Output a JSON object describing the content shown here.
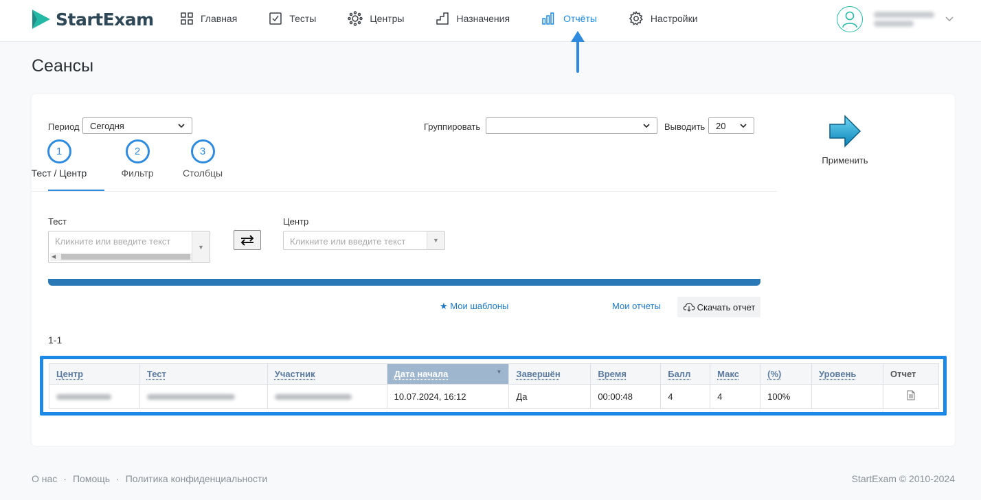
{
  "brand": {
    "name": "StartExam",
    "color": "#2f4858",
    "accent": "#24b9a6"
  },
  "nav": {
    "items": [
      {
        "label": "Главная",
        "icon": "grid-icon"
      },
      {
        "label": "Тесты",
        "icon": "checkbox-icon"
      },
      {
        "label": "Центры",
        "icon": "sun-icon"
      },
      {
        "label": "Назначения",
        "icon": "stairs-icon"
      },
      {
        "label": "Отчёты",
        "icon": "bar-chart-icon",
        "active": true
      },
      {
        "label": "Настройки",
        "icon": "gear-icon"
      }
    ]
  },
  "page": {
    "title": "Сеансы"
  },
  "filters": {
    "period_label": "Период",
    "period_value": "Сегодня",
    "group_label": "Группировать",
    "group_value": "",
    "show_label": "Выводить",
    "show_value": "20"
  },
  "steps": [
    {
      "num": "1",
      "label": "Тест / Центр",
      "active": true
    },
    {
      "num": "2",
      "label": "Фильтр"
    },
    {
      "num": "3",
      "label": "Столбцы"
    }
  ],
  "apply": {
    "label": "Применить",
    "icon": "arrow-right-icon"
  },
  "fields": {
    "test_label": "Тест",
    "test_placeholder": "Кликните или введите текст",
    "center_label": "Центр",
    "center_placeholder": "Кликните или введите текст"
  },
  "actions": {
    "templates": "★ Мои шаблоны",
    "my_reports": "Мои отчеты",
    "download": "Скачать отчет"
  },
  "results": {
    "range": "1-1"
  },
  "table": {
    "headers": [
      "Центр",
      "Тест",
      "Участник",
      "Дата начала",
      "Завершён",
      "Время",
      "Балл",
      "Макс",
      "(%)",
      "Уровень",
      "Отчет"
    ],
    "row": {
      "start": "10.07.2024, 16:12",
      "finished": "Да",
      "time": "00:00:48",
      "score": "4",
      "max": "4",
      "percent": "100%",
      "level": ""
    }
  },
  "footer": {
    "about": "О нас",
    "help": "Помощь",
    "privacy": "Политика конфиденциальности",
    "sep": "·",
    "copyright": "StartExam © 2010-2024"
  }
}
